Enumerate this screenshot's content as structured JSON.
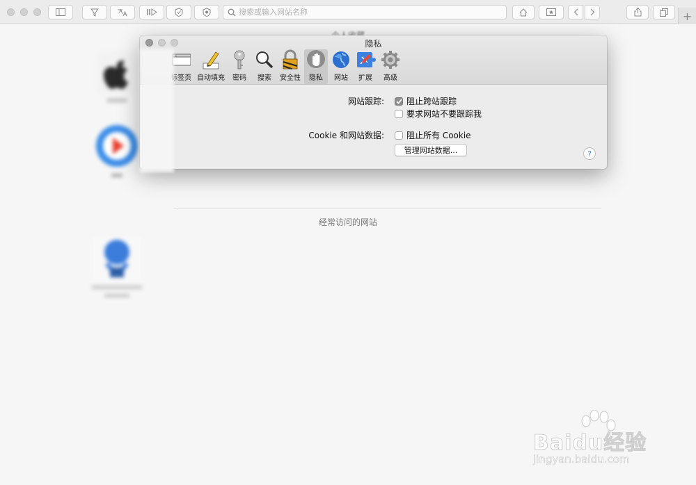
{
  "browser": {
    "search_placeholder": "搜索或输入网站名称",
    "new_tab_label": "+"
  },
  "newtab_page": {
    "favorites_title": "个人收藏",
    "frequent_title": "经常访问的网站"
  },
  "prefs": {
    "window_title": "隐私",
    "tabs": [
      {
        "label": "标签页",
        "icon": "tabs-icon"
      },
      {
        "label": "自动填充",
        "icon": "pencil-icon"
      },
      {
        "label": "密码",
        "icon": "key-icon"
      },
      {
        "label": "搜索",
        "icon": "magnifier-icon"
      },
      {
        "label": "安全性",
        "icon": "lock-icon"
      },
      {
        "label": "隐私",
        "icon": "hand-icon",
        "active": true
      },
      {
        "label": "网站",
        "icon": "globe-icon"
      },
      {
        "label": "扩展",
        "icon": "puzzle-icon"
      },
      {
        "label": "高级",
        "icon": "gear-icon"
      }
    ],
    "tracking_label": "网站跟踪:",
    "block_cross_site": "阻止跨站跟踪",
    "block_cross_site_checked": true,
    "ask_not_track": "要求网站不要跟踪我",
    "ask_not_track_checked": false,
    "cookie_label": "Cookie 和网站数据:",
    "block_all_cookies": "阻止所有 Cookie",
    "block_all_cookies_checked": false,
    "manage_button": "管理网站数据...",
    "help": "?"
  },
  "watermark": {
    "brand": "Baidu经验",
    "url": "jingyan.baidu.com"
  },
  "colors": {
    "accent_blue": "#3b7de0",
    "toolbar_bg": "#ececec",
    "page_bg": "#f6f6f6"
  }
}
